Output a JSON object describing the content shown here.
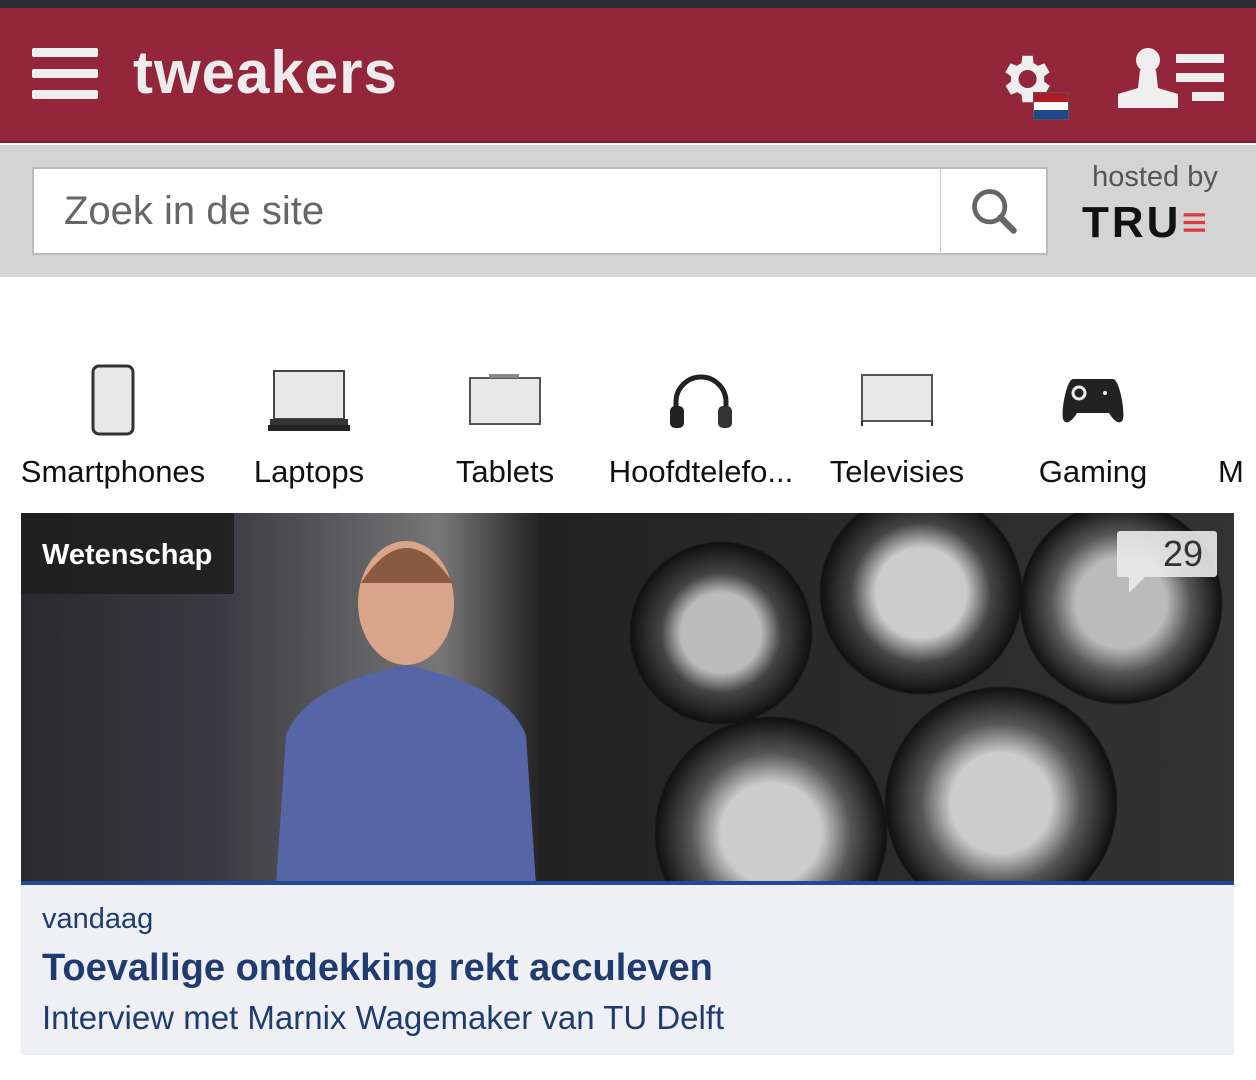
{
  "header": {
    "logo": "tweakers",
    "flag_colors": [
      "#ae1c28",
      "#ffffff",
      "#21468b"
    ],
    "brand_color": "#93263a"
  },
  "search": {
    "placeholder": "Zoek in de site",
    "hosted_by": "hosted by",
    "host_logo": "TRUE"
  },
  "categories": [
    {
      "label": "Smartphones",
      "icon": "smartphone-icon"
    },
    {
      "label": "Laptops",
      "icon": "laptop-icon"
    },
    {
      "label": "Tablets",
      "icon": "tablet-icon"
    },
    {
      "label": "Hoofdtelefo...",
      "icon": "headphones-icon"
    },
    {
      "label": "Televisies",
      "icon": "tv-icon"
    },
    {
      "label": "Gaming",
      "icon": "gamepad-icon"
    },
    {
      "label": "M",
      "icon": ""
    }
  ],
  "article": {
    "category": "Wetenschap",
    "comments": "29",
    "date": "vandaag",
    "title": "Toevallige ontdekking rekt acculeven",
    "subtitle": "Interview met Marnix Wagemaker van TU Delft"
  }
}
